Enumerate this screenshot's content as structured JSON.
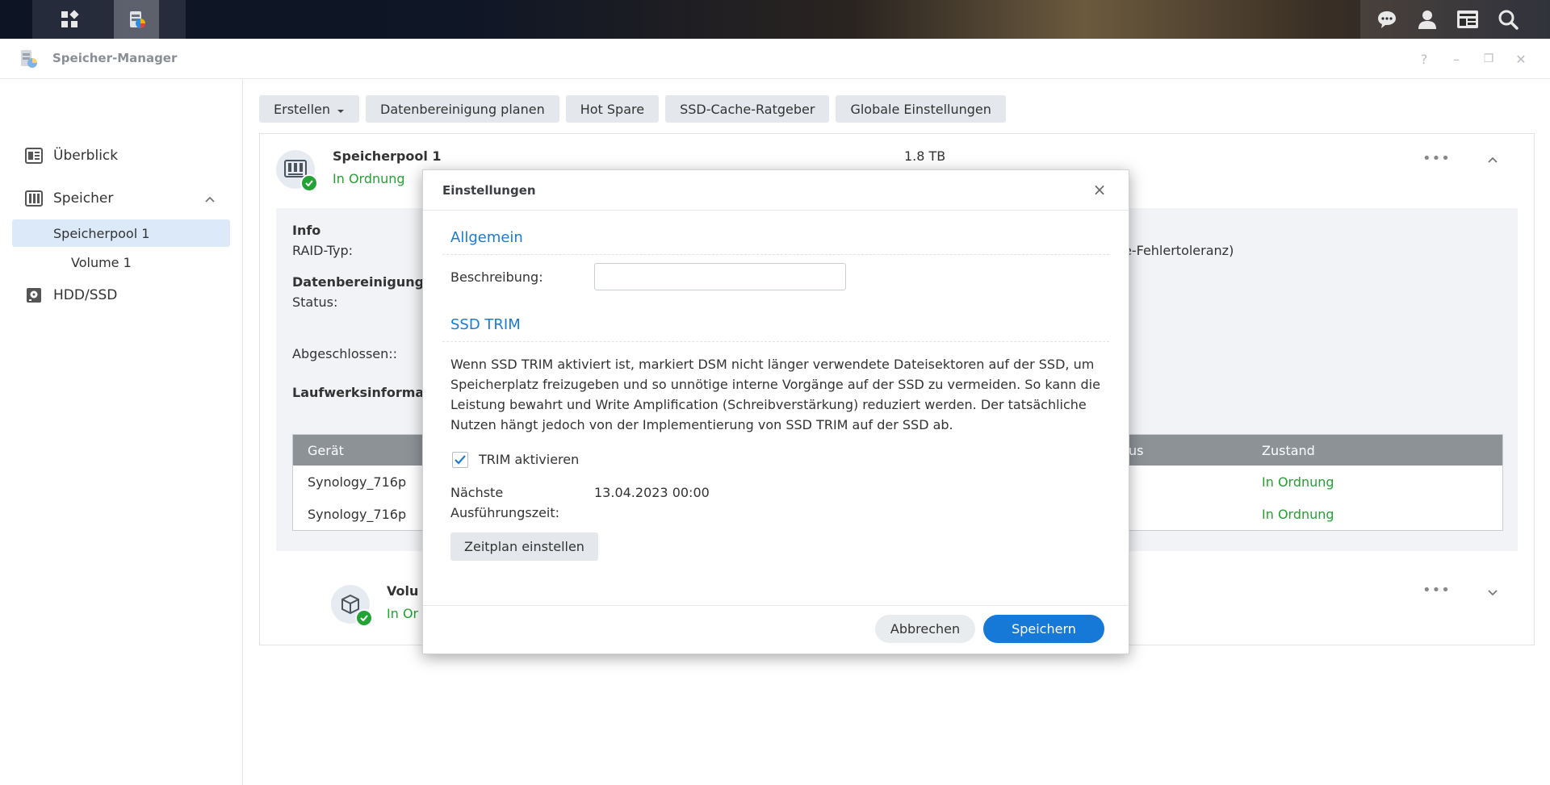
{
  "taskbar": {
    "left_icons": [
      "grid-icon",
      "storage-manager-icon"
    ],
    "right_icons": [
      "chat-icon",
      "user-icon",
      "widgets-icon",
      "search-icon"
    ]
  },
  "window": {
    "title": "Speicher-Manager",
    "controls": [
      "?",
      "–",
      "❐",
      "✕"
    ]
  },
  "sidebar": {
    "overview": "Überblick",
    "storage": "Speicher",
    "pool": "Speicherpool 1",
    "volume": "Volume 1",
    "hdd": "HDD/SSD"
  },
  "toolbar": {
    "create": "Erstellen",
    "scrub": "Datenbereinigung planen",
    "hotspare": "Hot Spare",
    "ssd_cache": "SSD-Cache-Ratgeber",
    "global": "Globale Einstellungen"
  },
  "pool": {
    "name": "Speicherpool 1",
    "status": "In Ordnung",
    "size": "1.8 TB",
    "info_heading": "Info",
    "raid_label": "RAID-Typ:",
    "raid_value_fragment": "e-Fehlertoleranz)",
    "scrub_heading": "Datenbereinigung",
    "status_label": "Status:",
    "completed_label": "Abgeschlossen::",
    "drives_heading": "Laufwerksinforma",
    "table": {
      "col_device": "Gerät",
      "col_status_fragment": "us",
      "col_state": "Zustand",
      "rows": [
        {
          "device": "Synology_716p",
          "state": "In Ordnung"
        },
        {
          "device": "Synology_716p",
          "state": "In Ordnung"
        }
      ]
    }
  },
  "volume": {
    "name_fragment": "Volu",
    "status_fragment": "In Or"
  },
  "dialog": {
    "title": "Einstellungen",
    "close": "×",
    "general_title": "Allgemein",
    "description_label": "Beschreibung:",
    "description_value": "",
    "ssd_trim_title": "SSD TRIM",
    "trim_description": "Wenn SSD TRIM aktiviert ist, markiert DSM nicht länger verwendete Dateisektoren auf der SSD, um Speicherplatz freizugeben und so unnötige interne Vorgänge auf der SSD zu vermeiden. So kann die Leistung bewahrt und Write Amplification (Schreibverstärkung) reduziert werden. Der tatsächliche Nutzen hängt jedoch von der Implementierung von SSD TRIM auf der SSD ab.",
    "trim_checkbox_label": "TRIM aktivieren",
    "trim_checked": true,
    "next_run_label_1": "Nächste",
    "next_run_label_2": "Ausführungszeit:",
    "next_run_value": "13.04.2023 00:00",
    "schedule_button": "Zeitplan einstellen",
    "cancel_button": "Abbrechen",
    "save_button": "Speichern"
  },
  "colors": {
    "accent": "#1a7bd0",
    "primary_button": "#1678d7",
    "ok_green": "#24a132",
    "selected_nav": "#dbe9f8"
  }
}
